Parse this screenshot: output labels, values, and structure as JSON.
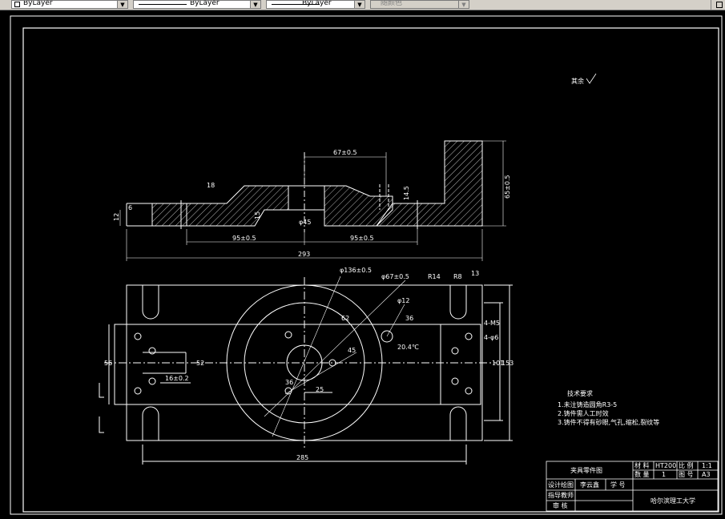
{
  "toolbar": {
    "color_dropdown": "ByLayer",
    "linetype_dropdown": "ByLayer",
    "lineweight_dropdown": "ByLayer",
    "plotstyle_dropdown": "随颜色"
  },
  "drawing": {
    "surface_mark": "其余",
    "front_view_dims": {
      "width_top": "67±0.5",
      "left_thk": "12",
      "step_small": "6",
      "inner_18": "18",
      "step_15": "15",
      "bore_45": "φ45",
      "depth_14": "14.5",
      "height_right": "65±0.5",
      "half_left": "95±0.5",
      "half_right": "95±0.5",
      "overall": "293"
    },
    "plan_view_dims": {
      "dia_large": "φ136±0.5",
      "dia_mid": "φ67±0.5",
      "dia_12": "φ12",
      "r14": "R14",
      "r8": "R8",
      "w13": "13",
      "hole_4m5": "4-M5",
      "hole_4phi6": "4-φ6",
      "slot_16": "16±0.2",
      "v_36": "36",
      "v_52": "52",
      "v_56": "56",
      "v_101": "101",
      "v_153": "153",
      "center_25": "25",
      "r_62": "62",
      "angle_36": "36",
      "angle_45": "45",
      "angle_20": "20.4℃",
      "overall_width": "285"
    },
    "tech_req": {
      "title": "技术要求",
      "item1": "1.未注铸造圆角R3-5",
      "item2": "2.铸件需人工时效",
      "item3": "3.铸件不得有砂眼,气孔,缩松,裂纹等"
    },
    "title_block": {
      "part_name": "夹具零件图",
      "material_label": "材 料",
      "material": "HT200",
      "scale_label": "比 例",
      "scale": "1:1",
      "qty_label": "数 量",
      "qty": "1",
      "drawing_no_label": "图 号",
      "drawing_no": "A3",
      "designer_label": "设计绘图",
      "designer": "李云鑫",
      "student_no_label": "学 号",
      "instructor_label": "指导教师",
      "reviewer_label": "审 核",
      "school": "哈尔滨理工大学"
    }
  }
}
